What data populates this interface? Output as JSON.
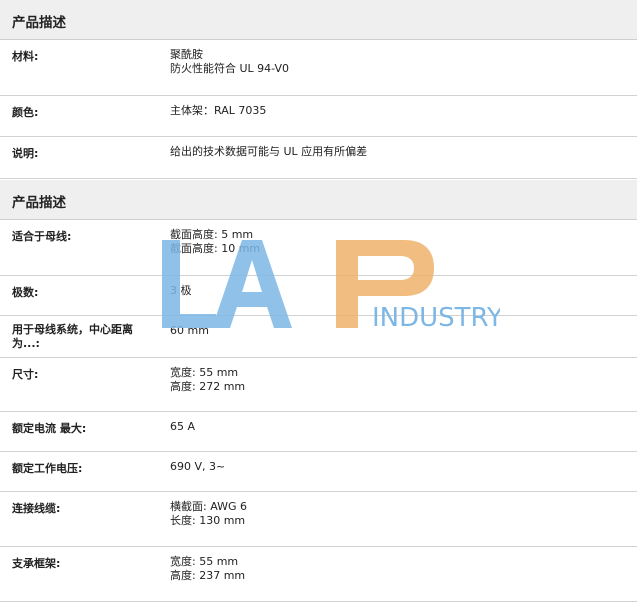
{
  "sections": [
    {
      "title": "产品描述",
      "rows": [
        {
          "label": "材料:",
          "lines": [
            "聚酰胺",
            "防火性能符合 UL 94-V0"
          ]
        },
        {
          "label": "颜色:",
          "lines": [
            "主体架：RAL 7035"
          ]
        },
        {
          "label": "说明:",
          "lines": [
            "给出的技术数据可能与 UL 应用有所偏差"
          ]
        }
      ]
    },
    {
      "title": "产品描述",
      "rows": [
        {
          "label": "适合于母线:",
          "lines": [
            "截面高度: 5 mm",
            "截面高度: 10 mm"
          ]
        },
        {
          "label": "极数:",
          "lines": [
            "3 极"
          ]
        },
        {
          "label": "用于母线系统，中心距离为...:",
          "lines": [
            "60 mm"
          ]
        },
        {
          "label": "尺寸:",
          "lines": [
            "宽度: 55 mm",
            "高度: 272 mm"
          ]
        },
        {
          "label": "额定电流 最大:",
          "lines": [
            "65 A"
          ]
        },
        {
          "label": "额定工作电压:",
          "lines": [
            "690 V, 3~"
          ]
        },
        {
          "label": "连接线缆:",
          "lines": [
            "横截面: AWG 6",
            "长度: 130 mm"
          ]
        },
        {
          "label": "支承框架:",
          "lines": [
            "宽度: 55 mm",
            "高度: 237 mm"
          ]
        }
      ]
    }
  ],
  "watermark": {
    "logo_text": "LAP",
    "industry_text": "INDUSTRY",
    "colors": {
      "blue": "#7db7e6",
      "orange": "#efb26a"
    }
  }
}
